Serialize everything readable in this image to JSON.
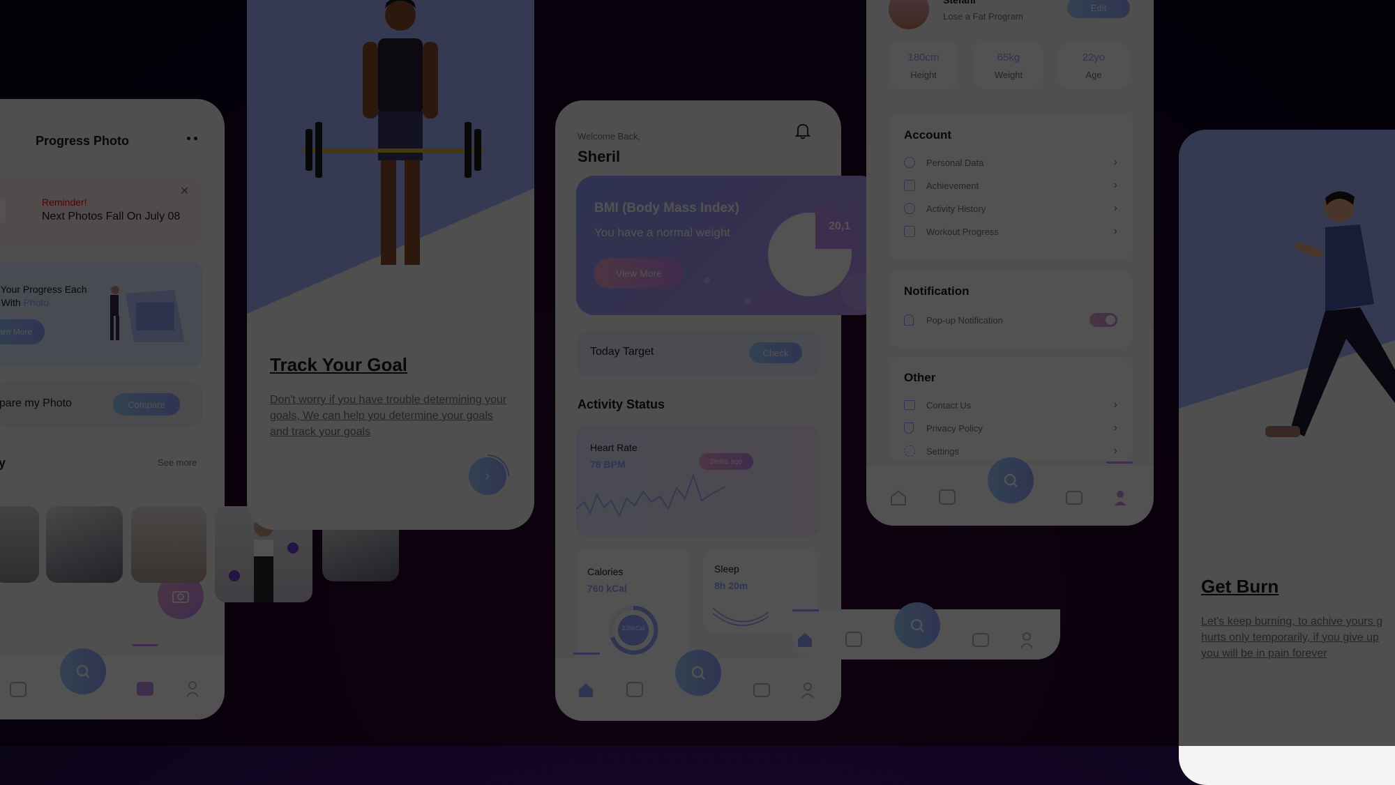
{
  "progress_screen": {
    "title": "Progress Photo",
    "reminder_label": "Reminder!",
    "reminder_text": "Next Photos Fall On July 08",
    "track_text_line1": "k Your Progress Each",
    "track_text_line2a": "h With ",
    "track_text_line2b": "Photo",
    "learn_more": "arn More",
    "compare_label": "npare my Photo",
    "compare_button": "Compare",
    "gallery_title": "y",
    "see_more": "See more"
  },
  "onboarding_goal": {
    "title": "Track Your Goal",
    "body": "Don't worry if you have trouble determining your goals, We can help you determine your goals and track your goals"
  },
  "home_screen": {
    "welcome": "Welcome Back,",
    "user_name": "Sheril",
    "bmi_title": "BMI (Body Mass Index)",
    "bmi_subtitle": "You have a normal weight",
    "bmi_button": "View More",
    "bmi_value": "20,1",
    "today_target": "Today Target",
    "check_button": "Check",
    "activity_status": "Activity Status",
    "heart_rate_label": "Heart Rate",
    "heart_rate_value": "78 BPM",
    "heart_rate_badge": "3mins ago",
    "calories_label": "Calories",
    "calories_value": "760 kCal",
    "calories_ring_text": "230kCal",
    "sleep_label": "Sleep",
    "sleep_value": "8h 20m"
  },
  "profile_screen": {
    "name": "Stefani",
    "program": "Lose a Fat Program",
    "edit_button": "Edit",
    "stats": [
      {
        "value": "180cm",
        "label": "Height"
      },
      {
        "value": "65kg",
        "label": "Weight"
      },
      {
        "value": "22yo",
        "label": "Age"
      }
    ],
    "account_title": "Account",
    "account_items": [
      "Personal Data",
      "Achievement",
      "Activity History",
      "Workout Progress"
    ],
    "notification_title": "Notification",
    "notification_item": "Pop-up Notification",
    "notification_on": true,
    "other_title": "Other",
    "other_items": [
      "Contact Us",
      "Privacy Policy",
      "Settings"
    ]
  },
  "onboarding_burn": {
    "title": "Get Burn",
    "line1": "Let's keep burning, to achive yours g",
    "line2": "hurts only temporarily, if you give up",
    "line3": "you will be in pain forever"
  },
  "colors": {
    "background": "#1a0524",
    "card": "#f4f4f6",
    "brand_blue": "#92a3fd",
    "brand_purple": "#c58bf2",
    "text_dark": "#1d1617",
    "reminder_red": "#ff0000"
  }
}
